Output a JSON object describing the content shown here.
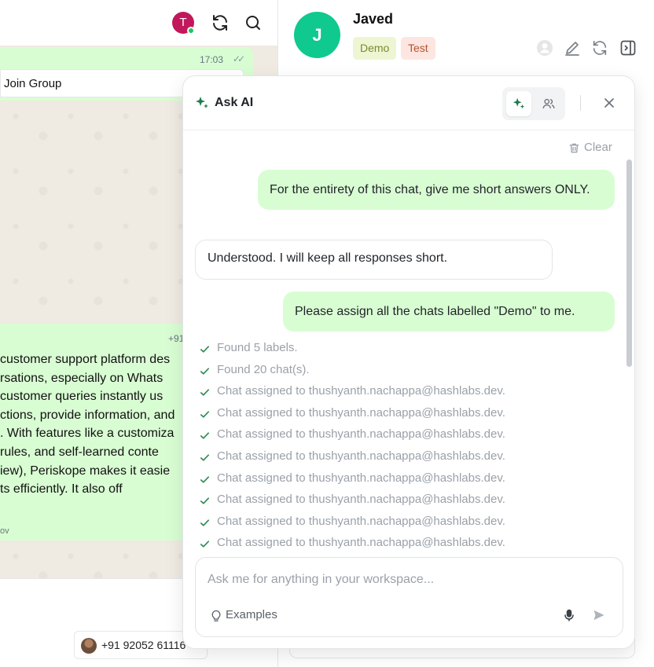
{
  "left_chat": {
    "avatar_letter": "T",
    "top_message": {
      "time": "17:03",
      "ticks": "✓✓",
      "link_preview": "Join Group"
    },
    "long_message": {
      "phone": "+91",
      "lines": [
        "customer support platform des",
        "rsations, especially on Whats",
        " customer queries instantly us",
        "ctions, provide information, and",
        ". With features like a customiza",
        " rules, and self-learned conte",
        "iew), Periskope makes it easie",
        "ts efficiently. It also off"
      ],
      "footer": "ov"
    },
    "contact_chip": {
      "number": "+91 92052 61116"
    }
  },
  "chat_header": {
    "avatar_letter": "J",
    "name": "Javed",
    "labels": [
      "Demo",
      "Test"
    ],
    "colors": {
      "avatar": "#10c98f",
      "demo_bg": "#eef5d3",
      "test_bg": "#fde6e1"
    }
  },
  "ask_ai": {
    "title": "Ask AI",
    "clear_label": "Clear",
    "messages": [
      {
        "role": "user",
        "text": "For the entirety of this chat, give me short answers ONLY."
      },
      {
        "role": "assistant",
        "text": "Understood. I will keep all responses short."
      },
      {
        "role": "user",
        "text": "Please assign all the chats labelled \"Demo\" to me."
      }
    ],
    "steps": [
      "Found 5 labels.",
      "Found 20 chat(s).",
      "Chat assigned to thushyanth.nachappa@hashlabs.dev.",
      "Chat assigned to thushyanth.nachappa@hashlabs.dev.",
      "Chat assigned to thushyanth.nachappa@hashlabs.dev.",
      "Chat assigned to thushyanth.nachappa@hashlabs.dev.",
      "Chat assigned to thushyanth.nachappa@hashlabs.dev.",
      "Chat assigned to thushyanth.nachappa@hashlabs.dev.",
      "Chat assigned to thushyanth.nachappa@hashlabs.dev.",
      "Chat assigned to thushyanth.nachappa@hashlabs.dev."
    ],
    "input_placeholder": "Ask me for anything in your workspace...",
    "examples_label": "Examples",
    "colors": {
      "user_bubble": "#d9fdd3",
      "check": "#2e8b57",
      "accent": "#1f7a4d"
    }
  }
}
